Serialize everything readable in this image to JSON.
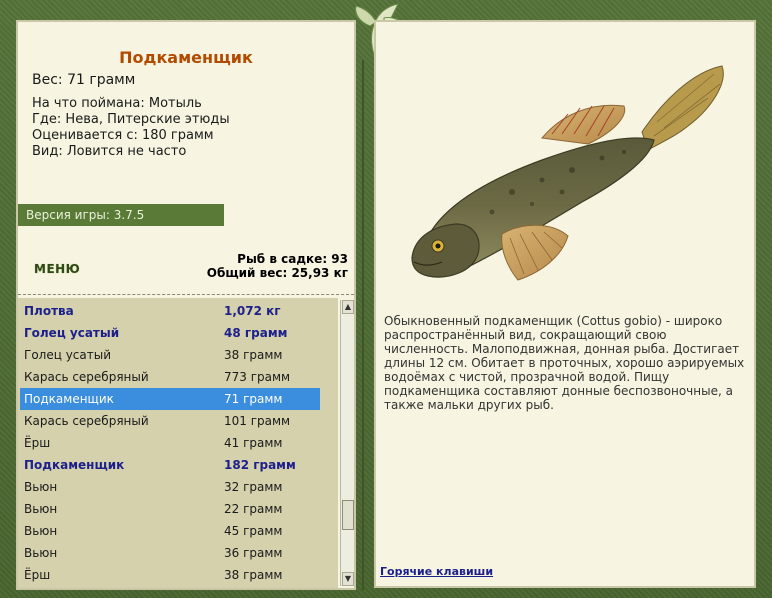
{
  "catch": {
    "title": "Подкаменщик",
    "weight": "Вес: 71 грамм",
    "bait": "На что поймана: Мотыль",
    "place": "Где: Нева, Питерские этюды",
    "rated": "Оценивается с: 180 грамм",
    "kind": "Вид: Ловится не часто"
  },
  "version": "Версия игры: 3.7.5",
  "menu_label": "МЕНЮ",
  "sadok": {
    "count": "Рыб в садке: 93",
    "total": "Общий вес: 25,93 кг"
  },
  "fish_list": [
    {
      "name": "Плотва",
      "weight": "1,072 кг",
      "style": "bold"
    },
    {
      "name": "Голец усатый",
      "weight": "48 грамм",
      "style": "bold"
    },
    {
      "name": "Голец усатый",
      "weight": "38 грамм",
      "style": ""
    },
    {
      "name": "Карась серебряный",
      "weight": "773 грамм",
      "style": ""
    },
    {
      "name": "Подкаменщик",
      "weight": "71 грамм",
      "style": "sel"
    },
    {
      "name": "Карась серебряный",
      "weight": "101 грамм",
      "style": ""
    },
    {
      "name": "Ёрш",
      "weight": "41 грамм",
      "style": ""
    },
    {
      "name": "Подкаменщик",
      "weight": "182 грамм",
      "style": "bold"
    },
    {
      "name": "Вьюн",
      "weight": "32 грамм",
      "style": ""
    },
    {
      "name": "Вьюн",
      "weight": "22 грамм",
      "style": ""
    },
    {
      "name": "Вьюн",
      "weight": "45 грамм",
      "style": ""
    },
    {
      "name": "Вьюн",
      "weight": "36 грамм",
      "style": ""
    },
    {
      "name": "Ёрш",
      "weight": "38 грамм",
      "style": ""
    }
  ],
  "description": "Обыкновенный подкаменщик (Cottus gobio) - широко распространённый вид, сокращающий свою численность. Малоподвижная, донная рыба. Достигает длины 12 см. Обитает в проточных, хорошо аэрируемых водоёмах с чистой, прозрачной водой. Пищу подкаменщика составляют донные беспозвоночные, а также мальки других рыб.",
  "hotkeys_label": "Горячие клавиши",
  "colors": {
    "frame": "#4f6b33",
    "panel": "#f7f5e1",
    "title": "#b24a00",
    "list_bg": "#d4d1ac",
    "selection": "#3b8ede",
    "bold_text": "#1c1f8c"
  }
}
